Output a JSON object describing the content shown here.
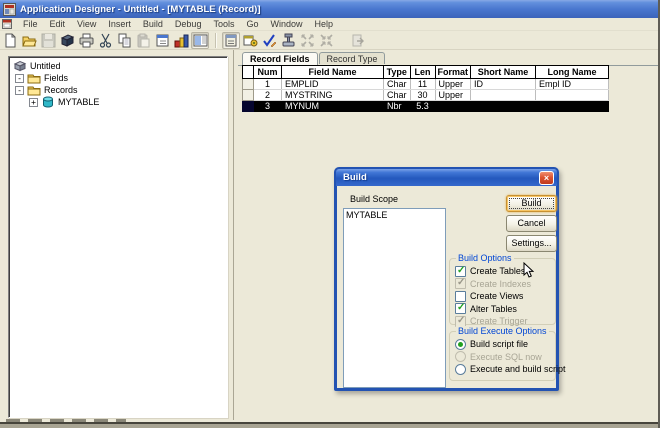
{
  "window": {
    "title": "Application Designer - Untitled - [MYTABLE (Record)]"
  },
  "menubar": {
    "items": [
      "File",
      "Edit",
      "View",
      "Insert",
      "Build",
      "Debug",
      "Tools",
      "Go",
      "Window",
      "Help"
    ]
  },
  "toolbar": {
    "icons": [
      {
        "name": "new-icon",
        "state": "normal"
      },
      {
        "name": "open-icon",
        "state": "normal"
      },
      {
        "name": "save-icon",
        "state": "disabled"
      },
      {
        "name": "save-project-icon",
        "state": "normal"
      },
      {
        "name": "print-icon",
        "state": "normal"
      },
      {
        "name": "cut-icon",
        "state": "normal"
      },
      {
        "name": "copy-icon",
        "state": "normal"
      },
      {
        "name": "paste-icon",
        "state": "disabled"
      },
      {
        "name": "project-properties-icon",
        "state": "normal"
      },
      {
        "name": "build-icon",
        "state": "normal"
      },
      {
        "name": "toggle-project-workspace-icon",
        "state": "pressed"
      },
      {
        "name": "object-properties-icon",
        "state": "pressed"
      },
      {
        "name": "record-properties-icon",
        "state": "normal"
      },
      {
        "name": "validate-icon",
        "state": "normal"
      },
      {
        "name": "record-type-icon",
        "state": "normal"
      },
      {
        "name": "expand-arrows-icon",
        "state": "disabled"
      },
      {
        "name": "collapse-arrows-icon",
        "state": "disabled"
      },
      {
        "name": "next-definition-icon",
        "state": "disabled"
      }
    ]
  },
  "project_tree": {
    "items": [
      {
        "label": "Untitled",
        "icon": "project-icon",
        "expander": ""
      },
      {
        "label": "Fields",
        "icon": "folder-icon",
        "expander": "-"
      },
      {
        "label": "Records",
        "icon": "folder-icon",
        "expander": "-"
      },
      {
        "label": "MYTABLE",
        "icon": "record-icon",
        "expander": "+"
      }
    ]
  },
  "record_window": {
    "tabs": [
      {
        "label": "Record Fields",
        "active": true
      },
      {
        "label": "Record Type",
        "active": false
      }
    ],
    "grid": {
      "columns": [
        "Num",
        "Field Name",
        "Type",
        "Len",
        "Format",
        "Short Name",
        "Long Name"
      ],
      "rows": [
        {
          "num": "1",
          "field_name": "EMPLID",
          "type": "Char",
          "len": "11",
          "format": "Upper",
          "short_name": "ID",
          "long_name": "Empl ID",
          "selected": false
        },
        {
          "num": "2",
          "field_name": "MYSTRING",
          "type": "Char",
          "len": "30",
          "format": "Upper",
          "short_name": "",
          "long_name": "",
          "selected": false
        },
        {
          "num": "3",
          "field_name": "MYNUM",
          "type": "Nbr",
          "len": "5.3",
          "format": "",
          "short_name": "",
          "long_name": "",
          "selected": true
        }
      ]
    }
  },
  "build_dialog": {
    "title": "Build",
    "close_glyph": "×",
    "scope_label": "Build Scope",
    "scope_items": [
      "MYTABLE"
    ],
    "buttons": {
      "build": "Build",
      "cancel": "Cancel",
      "settings": "Settings..."
    },
    "build_options": {
      "title": "Build Options",
      "items": [
        {
          "label": "Create Tables",
          "checked": true,
          "enabled": true
        },
        {
          "label": "Create Indexes",
          "checked": true,
          "enabled": false
        },
        {
          "label": "Create Views",
          "checked": false,
          "enabled": true
        },
        {
          "label": "Alter Tables",
          "checked": true,
          "enabled": true
        },
        {
          "label": "Create Trigger",
          "checked": true,
          "enabled": false
        }
      ]
    },
    "execute_options": {
      "title": "Build Execute Options",
      "items": [
        {
          "label": "Build script file",
          "selected": true,
          "enabled": true
        },
        {
          "label": "Execute SQL now",
          "selected": false,
          "enabled": false
        },
        {
          "label": "Execute and build script",
          "selected": false,
          "enabled": true
        }
      ]
    }
  },
  "colors": {
    "titlebar_blue": "#4a77cf",
    "dialog_border_blue": "#2353b2",
    "group_caption_blue": "#0046d5",
    "check_green": "#21a121",
    "selected_row_bg": "#000000",
    "disabled_text": "#a8a595",
    "close_button_red": "#d44a2a",
    "face_beige": "#ece9d8"
  }
}
